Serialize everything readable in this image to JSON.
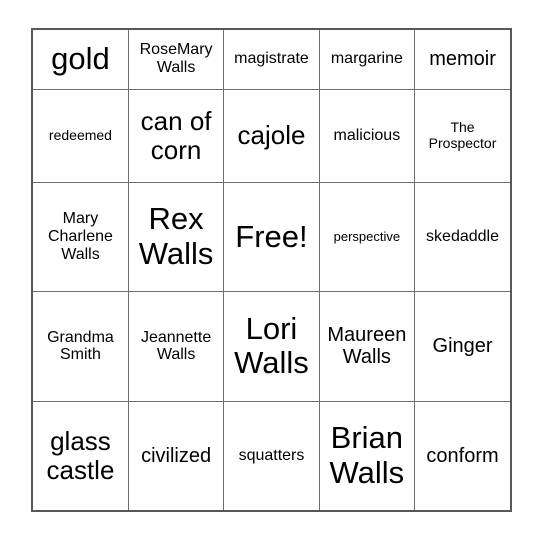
{
  "card": {
    "rows": 5,
    "columns": 5,
    "border_color": "#58585a",
    "gridline_color": "#6e6e70",
    "background_color": "#ffffff",
    "text_color": "#000000",
    "cells": [
      [
        {
          "text": "gold",
          "size": "fs-xl"
        },
        {
          "text": "RoseMary Walls",
          "size": "fs-sm"
        },
        {
          "text": "magistrate",
          "size": "fs-sm"
        },
        {
          "text": "margarine",
          "size": "fs-sm"
        },
        {
          "text": "memoir",
          "size": "fs-md"
        }
      ],
      [
        {
          "text": "redeemed",
          "size": "fs-xs"
        },
        {
          "text": "can of corn",
          "size": "fs-lg"
        },
        {
          "text": "cajole",
          "size": "fs-lg"
        },
        {
          "text": "malicious",
          "size": "fs-sm"
        },
        {
          "text": "The Prospector",
          "size": "fs-xs"
        }
      ],
      [
        {
          "text": "Mary Charlene Walls",
          "size": "fs-sm"
        },
        {
          "text": "Rex Walls",
          "size": "fs-xl"
        },
        {
          "text": "Free!",
          "size": "fs-xl"
        },
        {
          "text": "perspective",
          "size": "fs-xxs"
        },
        {
          "text": "skedaddle",
          "size": "fs-sm"
        }
      ],
      [
        {
          "text": "Grandma Smith",
          "size": "fs-sm"
        },
        {
          "text": "Jeannette Walls",
          "size": "fs-sm"
        },
        {
          "text": "Lori Walls",
          "size": "fs-xl"
        },
        {
          "text": "Maureen Walls",
          "size": "fs-md"
        },
        {
          "text": "Ginger",
          "size": "fs-md"
        }
      ],
      [
        {
          "text": "glass castle",
          "size": "fs-lg"
        },
        {
          "text": "civilized",
          "size": "fs-md"
        },
        {
          "text": "squatters",
          "size": "fs-sm"
        },
        {
          "text": "Brian Walls",
          "size": "fs-xl"
        },
        {
          "text": "conform",
          "size": "fs-md"
        }
      ]
    ]
  }
}
